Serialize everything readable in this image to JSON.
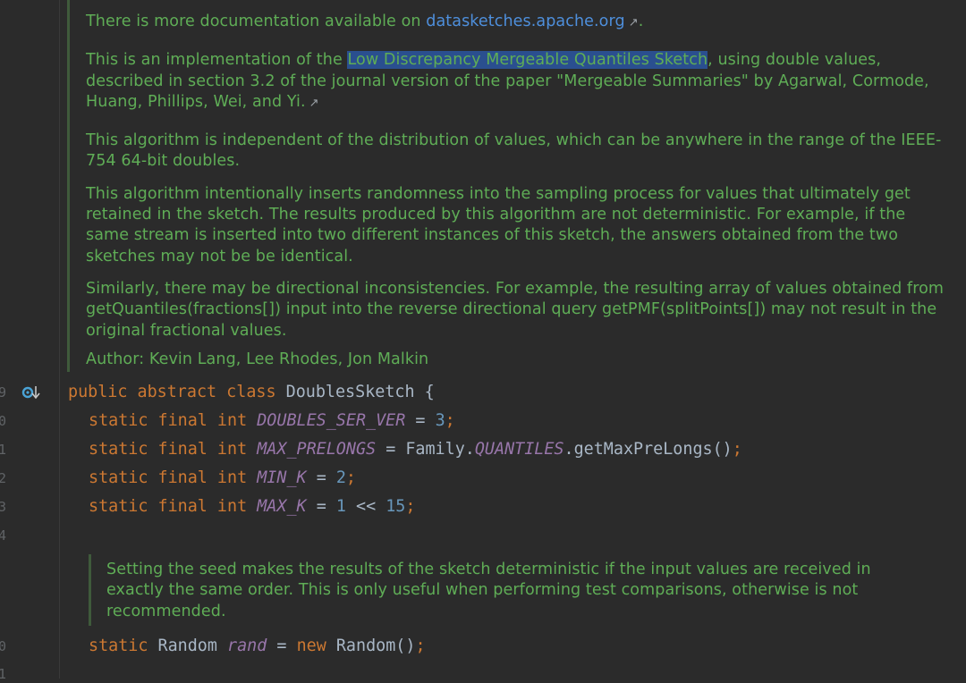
{
  "gutter": {
    "line_numbers": [
      "9",
      "0",
      "1",
      "2",
      "3",
      "4",
      "0",
      "1"
    ]
  },
  "doc_top": {
    "p1_prefix": "There is more documentation available on ",
    "p1_link": "datasketches.apache.org",
    "p1_suffix": ".",
    "p2_prefix": "This is an implementation of the ",
    "p2_link": "Low Discrepancy Mergeable Quantiles Sketch",
    "p2_text": ", using double values, described in section 3.2 of the journal version of the paper \"Mergeable Summaries\" by Agarwal, Cormode, Huang, Phillips, Wei, and Yi.",
    "p3": "This algorithm is independent of the distribution of values, which can be anywhere in the range of the IEEE-754 64-bit doubles.",
    "p4": "This algorithm intentionally inserts randomness into the sampling process for values that ultimately get retained in the sketch. The results produced by this algorithm are not deterministic. For example, if the same stream is inserted into two different instances of this sketch, the answers obtained from the two sketches may not be be identical.",
    "p5": "Similarly, there may be directional inconsistencies. For example, the resulting array of values obtained from getQuantiles(fractions[]) input into the reverse directional query getPMF(splitPoints[]) may not result in the original fractional values.",
    "author": "Author: Kevin Lang, Lee Rhodes, Jon Malkin"
  },
  "code": {
    "class_decl": {
      "kw1": "public",
      "kw2": "abstract",
      "kw3": "class",
      "name": "DoublesSketch",
      "brace": "{"
    },
    "fields": [
      {
        "mods": "static final int",
        "name": "DOUBLES_SER_VER",
        "eq": "=",
        "value": "3",
        "end": ";"
      },
      {
        "mods": "static final int",
        "name": "MAX_PRELONGS",
        "eq": "=",
        "pre": "Family.",
        "const": "QUANTILES",
        "call": ".getMaxPreLongs()",
        "end": ";"
      },
      {
        "mods": "static final int",
        "name": "MIN_K",
        "eq": "=",
        "value": "2",
        "end": ";"
      },
      {
        "mods": "static final int",
        "name": "MAX_K",
        "eq": "=",
        "v1": "1",
        "op": "<<",
        "v2": "15",
        "end": ";"
      }
    ],
    "rand_line": {
      "kw": "static",
      "type": "Random",
      "name": "rand",
      "eq": "=",
      "new": "new",
      "ctor": "Random()",
      "end": ";"
    }
  },
  "doc_seed": {
    "text": "Setting the seed makes the results of the sketch deterministic if the input values are received in exactly the same order. This is only useful when performing test comparisons, otherwise is not recommended."
  }
}
